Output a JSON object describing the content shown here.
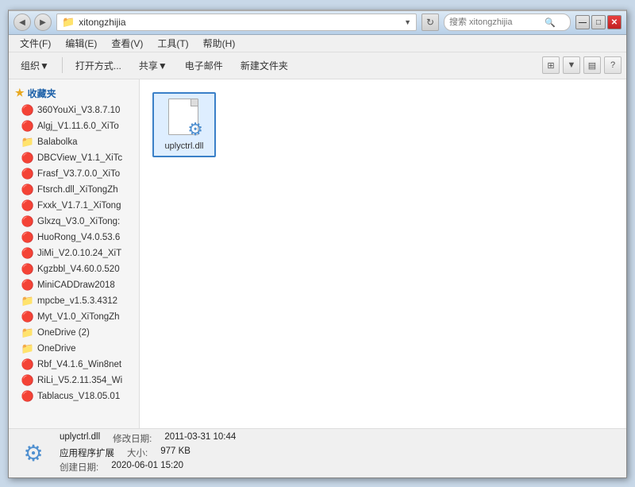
{
  "window": {
    "title": "xitongzhijia",
    "controls": {
      "minimize": "—",
      "maximize": "□",
      "close": "✕"
    }
  },
  "titlebar": {
    "folder_icon": "📁",
    "path": "xitongzhijia",
    "refresh_icon": "↻",
    "search_placeholder": "搜索 xitongzhijia",
    "dropdown_arrow": "▼"
  },
  "menu": {
    "items": [
      "文件(F)",
      "编辑(E)",
      "查看(V)",
      "工具(T)",
      "帮助(H)"
    ]
  },
  "toolbar": {
    "organize": "组织▼",
    "open": "打开方式...",
    "share": "共享▼",
    "email": "电子邮件",
    "new_folder": "新建文件夹",
    "view_icon1": "⊞",
    "view_icon2": "▤",
    "help_icon": "?"
  },
  "sidebar": {
    "header": "收藏夹",
    "items": [
      {
        "label": "360YouXi_V3.8.7.10",
        "icon": "🔴"
      },
      {
        "label": "Algj_V1.11.6.0_XiTo",
        "icon": "🔴"
      },
      {
        "label": "Balabolka",
        "icon": "📁"
      },
      {
        "label": "DBCView_V1.1_XiTc",
        "icon": "🔴"
      },
      {
        "label": "Frasf_V3.7.0.0_XiTo",
        "icon": "🔴"
      },
      {
        "label": "Ftsrch.dll_XiTongZh",
        "icon": "🔴"
      },
      {
        "label": "Fxxk_V1.7.1_XiTong",
        "icon": "🔴"
      },
      {
        "label": "Glxzq_V3.0_XiTong:",
        "icon": "🔴"
      },
      {
        "label": "HuoRong_V4.0.53.6",
        "icon": "🔴"
      },
      {
        "label": "JiMi_V2.0.10.24_XiT",
        "icon": "🔴"
      },
      {
        "label": "Kgzbbl_V4.60.0.520",
        "icon": "🔴"
      },
      {
        "label": "MiniCADDraw2018",
        "icon": "🔴"
      },
      {
        "label": "mpcbe_v1.5.3.4312",
        "icon": "📁"
      },
      {
        "label": "Myt_V1.0_XiTongZh",
        "icon": "🔴"
      },
      {
        "label": "OneDrive (2)",
        "icon": "📁"
      },
      {
        "label": "OneDrive",
        "icon": "📁"
      },
      {
        "label": "Rbf_V4.1.6_Win8net",
        "icon": "🔴"
      },
      {
        "label": "RiLi_V5.2.11.354_Wi",
        "icon": "🔴"
      },
      {
        "label": "Tablacus_V18.05.01",
        "icon": "🔴"
      }
    ]
  },
  "content": {
    "file": {
      "name": "uplyctrl.dll",
      "icon_type": "dll"
    }
  },
  "statusbar": {
    "file_name": "uplyctrl.dll",
    "modified_label": "修改日期:",
    "modified_value": "2011-03-31 10:44",
    "type_label": "应用程序扩展",
    "size_label": "大小:",
    "size_value": "977 KB",
    "created_label": "创建日期:",
    "created_value": "2020-06-01 15:20"
  }
}
